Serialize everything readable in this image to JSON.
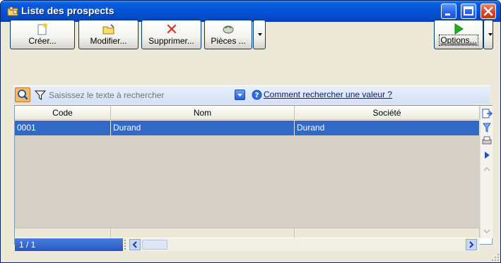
{
  "window": {
    "title": "Liste des prospects"
  },
  "toolbar": {
    "create_label": "Créer...",
    "modify_label": "Modifier...",
    "delete_label": "Supprimer...",
    "pieces_label": "Pièces ...",
    "options_label": "Options..."
  },
  "search": {
    "placeholder": "Saisissez le texte à rechercher",
    "help_link": "Comment rechercher une valeur ?"
  },
  "table": {
    "columns": [
      "Code",
      "Nom",
      "Société"
    ],
    "rows": [
      {
        "code": "0001",
        "nom": "Durand",
        "societe": "Durand"
      }
    ]
  },
  "footer": {
    "counter": "1 / 1"
  },
  "colors": {
    "titlebar": "#0553d6",
    "selection": "#3169c6",
    "link": "#0a246a"
  }
}
